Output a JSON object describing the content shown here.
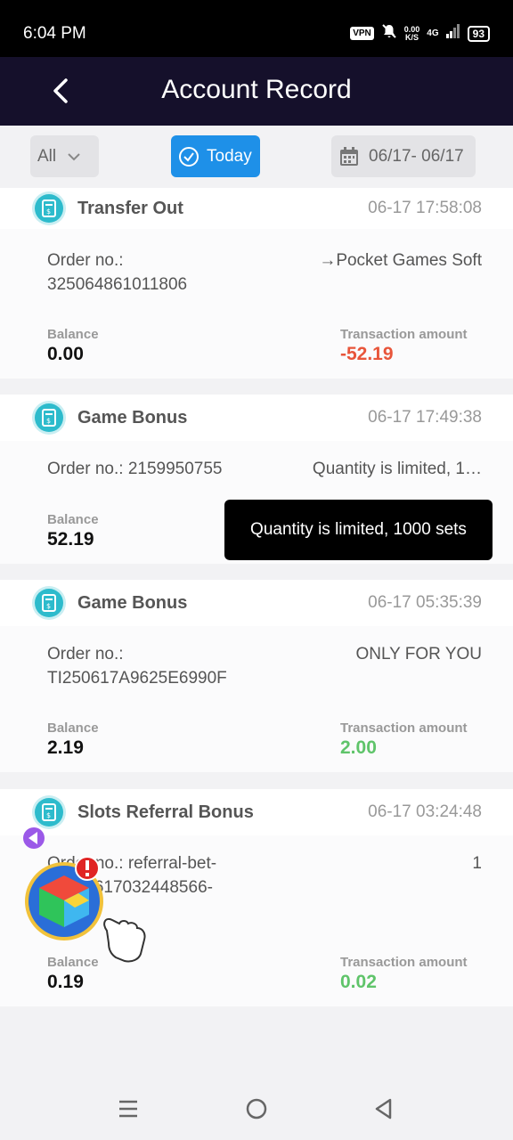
{
  "status": {
    "time": "6:04 PM",
    "vpn": "VPN",
    "net_speed_top": "0.00",
    "net_speed_bottom": "K/S",
    "net_type": "4G",
    "battery": "93"
  },
  "header": {
    "title": "Account Record"
  },
  "filters": {
    "type_value": "All",
    "today_label": "Today",
    "date_range": "06/17- 06/17"
  },
  "records": [
    {
      "title": "Transfer Out",
      "time": "06-17 17:58:08",
      "order_label": "Order no.:",
      "order_no": "325064861011806",
      "remark": "→Pocket Games Soft",
      "balance_label": "Balance",
      "balance": "0.00",
      "amount_label": "Transaction amount",
      "amount": "-52.19"
    },
    {
      "title": "Game Bonus",
      "time": "06-17 17:49:38",
      "order_label": "Order no.: 2159950755",
      "remark": "Quantity is limited, 1…",
      "balance_label": "Balance",
      "balance": "52.19"
    },
    {
      "title": "Game Bonus",
      "time": "06-17 05:35:39",
      "order_label": "Order no.:",
      "order_no": "TI250617A9625E6990F",
      "remark": "ONLY FOR YOU",
      "balance_label": "Balance",
      "balance": "2.19",
      "amount_label": "Transaction amount",
      "amount": "2.00"
    },
    {
      "title": "Slots Referral Bonus",
      "time": "06-17 03:24:48",
      "order_label": "Order no.: referral-bet-",
      "order_no": "20250617032448566-",
      "remark": "1",
      "balance_label": "Balance",
      "balance": "0.19",
      "amount_label": "Transaction amount",
      "amount": "0.02"
    }
  ],
  "tooltip": "Quantity is limited, 1000 sets",
  "colors": {
    "header_bg": "#15102b",
    "accent": "#1e90e8",
    "negative": "#e8553a",
    "positive": "#5fc46a"
  },
  "icons": {
    "back": "chevron-left-icon",
    "dropdown": "chevron-down-icon",
    "check": "check-circle-icon",
    "calendar": "calendar-icon",
    "record": "receipt-icon",
    "nav_menu": "menu-icon",
    "nav_home": "home-icon",
    "nav_back": "back-triangle-icon"
  }
}
